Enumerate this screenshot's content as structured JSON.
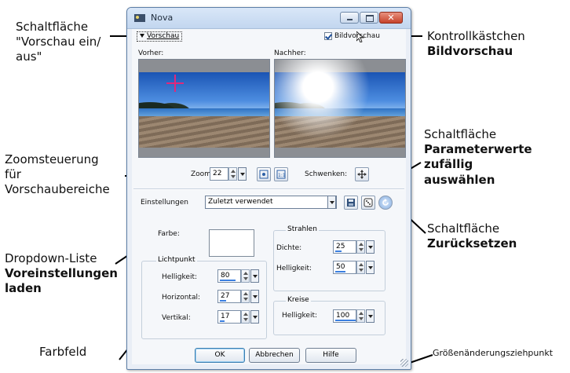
{
  "annotations": {
    "toggle": [
      "Schaltfläche",
      "\"Vorschau ein/",
      "aus\""
    ],
    "checkbox": [
      "Kontrollkästchen",
      "Bildvorschau"
    ],
    "zoom": [
      "Zoomsteuerung",
      "für",
      "Vorschaubereiche"
    ],
    "random": [
      "Schaltfläche",
      "Parameterwerte",
      "zufällig",
      "auswählen"
    ],
    "reset": [
      "Schaltfläche",
      "Zurücksetzen"
    ],
    "presets": [
      "Dropdown-Liste",
      "Voreinstellungen",
      "laden"
    ],
    "colorfield": "Farbfeld",
    "resize": "Größenänderungsziehpunkt"
  },
  "dialog": {
    "title": "Nova",
    "preview_toggle": "Vorschau",
    "image_preview_label": "Bildvorschau",
    "image_preview_checked": true,
    "before_label": "Vorher:",
    "after_label": "Nachher:",
    "zoom_label": "Zoom:",
    "zoom_value": "22",
    "pan_label": "Schwenken:",
    "presets_label": "Einstellungen",
    "presets_value": "Zuletzt verwendet",
    "color_label": "Farbe:",
    "color_value": "#ffffff",
    "lightpoint": {
      "title": "Lichtpunkt",
      "brightness_label": "Helligkeit:",
      "brightness_value": "80",
      "horizontal_label": "Horizontal:",
      "horizontal_value": "27",
      "vertical_label": "Vertikal:",
      "vertical_value": "17"
    },
    "rays": {
      "title": "Strahlen",
      "density_label": "Dichte:",
      "density_value": "25",
      "brightness_label": "Helligkeit:",
      "brightness_value": "50"
    },
    "circles": {
      "title": "Kreise",
      "brightness_label": "Helligkeit:",
      "brightness_value": "100"
    },
    "ok": "OK",
    "cancel": "Abbrechen",
    "help": "Hilfe"
  }
}
